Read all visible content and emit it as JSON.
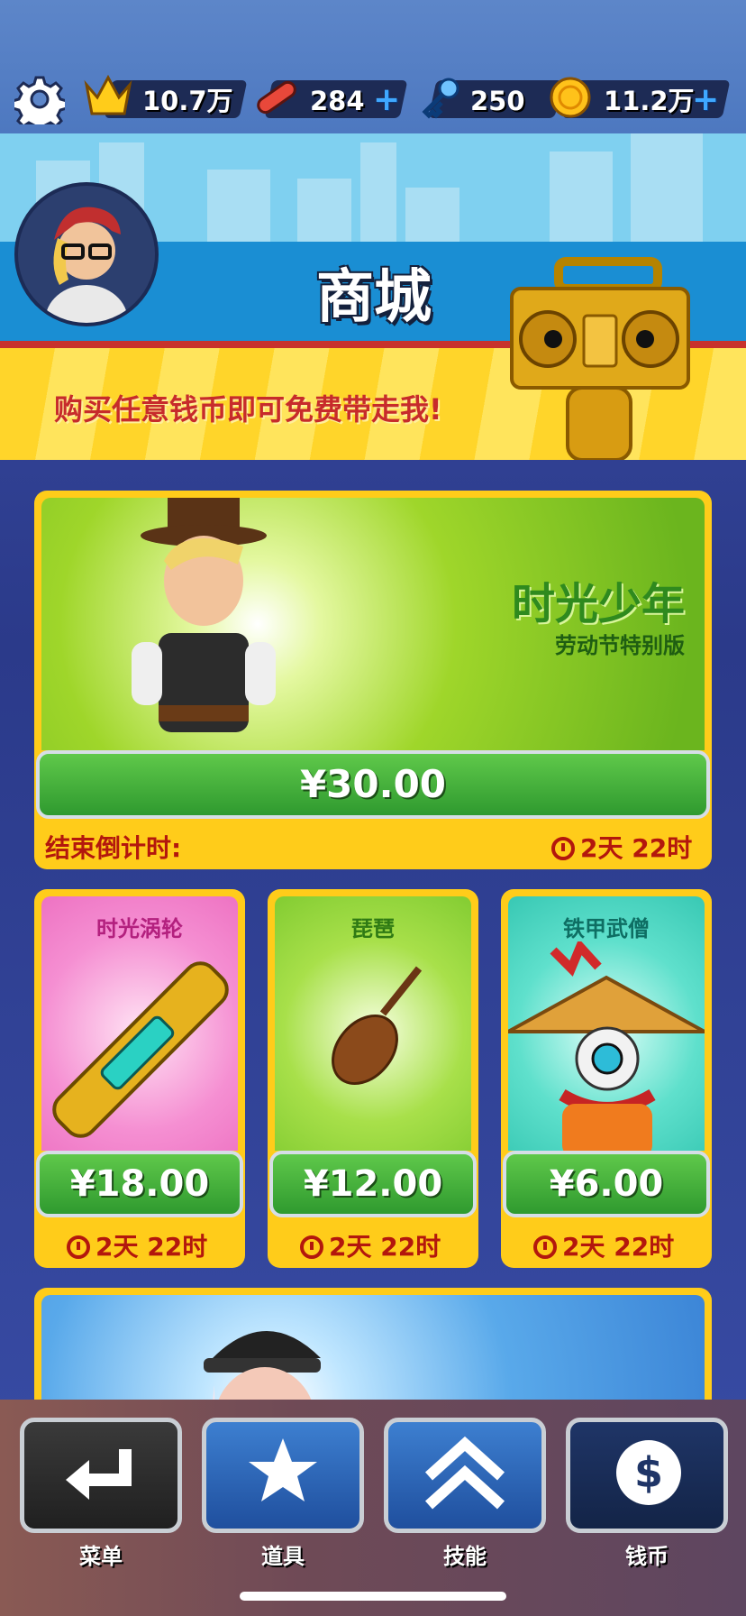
{
  "top_bar": {
    "settings_icon": "gear-icon",
    "score": "10.7万",
    "hoverboards": "284",
    "keys": "250",
    "coins": "11.2万",
    "plus_glyph": "+"
  },
  "banner": {
    "title": "商城",
    "promo_text": "购买任意钱币即可免费带走我!"
  },
  "featured_offer": {
    "title": "时光少年",
    "subtitle": "劳动节特别版",
    "price": "¥30.00",
    "countdown_label": "结束倒计时:",
    "countdown_value": "2天 22时"
  },
  "items": [
    {
      "title": "时光涡轮",
      "price": "¥18.00",
      "timer": "2天 22时",
      "color": "#f06fc0"
    },
    {
      "title": "琵琶",
      "price": "¥12.00",
      "timer": "2天 22时",
      "color": "#7ccf2f"
    },
    {
      "title": "铁甲武僧",
      "price": "¥6.00",
      "timer": "2天 22时",
      "color": "#2ec9b5"
    }
  ],
  "bottom_nav": [
    {
      "label": "菜单",
      "icon": "return-arrow-icon"
    },
    {
      "label": "道具",
      "icon": "star-icon"
    },
    {
      "label": "技能",
      "icon": "double-chevron-up-icon"
    },
    {
      "label": "钱币",
      "icon": "dollar-coin-icon"
    }
  ],
  "colors": {
    "accent_yellow": "#ffcc1a",
    "price_green": "#3fae37",
    "timer_red": "#b3170d",
    "stat_plus": "#3fa8ff"
  }
}
